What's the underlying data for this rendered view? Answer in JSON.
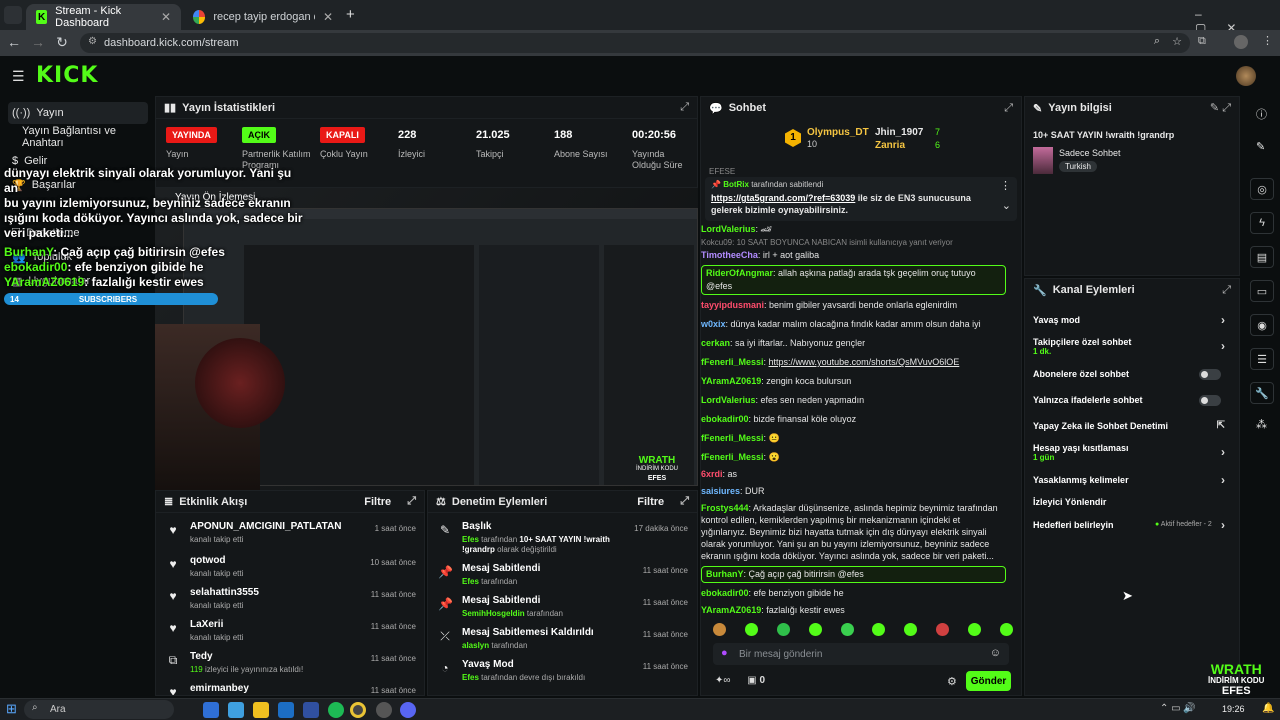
{
  "browser": {
    "tabs": [
      {
        "title": "Stream - Kick Dashboard",
        "active": true
      },
      {
        "title": "recep tayip erdogan dogum gu",
        "active": false
      }
    ],
    "url": "dashboard.kick.com/stream"
  },
  "sidebar": {
    "items": [
      {
        "label": "Yayın"
      },
      {
        "label": "Yayın Bağlantısı ve Anahtarı"
      },
      {
        "label": "Gelir"
      },
      {
        "label": "Başarılar"
      },
      {
        "label": "Denetleme"
      },
      {
        "label": "Topluluk"
      },
      {
        "label": "Uygulamalar"
      }
    ]
  },
  "stats": {
    "title": "Yayın İstatistikleri",
    "items": [
      {
        "value": "YAYINDA",
        "label": "Yayın"
      },
      {
        "value": "AÇIK",
        "label": "Partnerlik Katılım Programı"
      },
      {
        "value": "KAPALI",
        "label": "Çoklu Yayın"
      },
      {
        "value": "228",
        "label": "İzleyici"
      },
      {
        "value": "21.025",
        "label": "Takipçi"
      },
      {
        "value": "188",
        "label": "Abone Sayısı"
      },
      {
        "value": "00:20:56",
        "label": "Yayında Olduğu Süre"
      }
    ]
  },
  "preview": {
    "title": "Yayın Ön İzlemesi",
    "overlay_lines": [
      "dünyayı elektrik sinyali olarak yorumluyor. Yani şu an",
      "bu yayını izlemiyorsunuz, beyniniz sadece ekranın",
      "ışığını koda döküyor. Yayıncı aslında yok, sadece bir",
      "veri paketi..."
    ],
    "overlay_chat": [
      {
        "user": "BurhanY",
        "text": ": Çağ açıp çağ bitirirsin @efes"
      },
      {
        "user": "ebokadir00",
        "text": ": efe benziyon gibide he"
      },
      {
        "user": "YAramAZ0619",
        "text": ": fazlalığı kestir ewes"
      }
    ],
    "subs_count": "14",
    "subs_label": "SUBSCRIBERS",
    "watermark_line1": "WRATH",
    "watermark_line2": "İNDİRİM KODU",
    "watermark_line3": "EFES"
  },
  "activity": {
    "title": "Etkinlik Akışı",
    "filter": "Filtre",
    "rows": [
      {
        "name": "APONUN_AMCIGINI_PATLATAN",
        "sub": "kanalı takip etti",
        "time": "1 saat önce"
      },
      {
        "name": "qotwod",
        "sub": "kanalı takip etti",
        "time": "10 saat önce"
      },
      {
        "name": "selahattin3555",
        "sub": "kanalı takip etti",
        "time": "11 saat önce"
      },
      {
        "name": "LaXerii",
        "sub": "kanalı takip etti",
        "time": "11 saat önce"
      },
      {
        "name": "Tedy",
        "sub_highlight": "119",
        "sub": " izleyici ile yayınınıza katıldı!",
        "time": "11 saat önce"
      },
      {
        "name": "emirmanbey",
        "sub": "",
        "time": "11 saat önce"
      }
    ]
  },
  "modlog": {
    "title": "Denetim Eylemleri",
    "filter": "Filtre",
    "rows": [
      {
        "name": "Başlık",
        "who": "Efes",
        "sub": " tarafından ",
        "bold2": "10+ SAAT YAYIN !wraith !grandrp",
        "sub2": " olarak değiştirildi",
        "time": "17 dakika önce"
      },
      {
        "name": "Mesaj Sabitlendi",
        "who": "Efes",
        "sub": " tarafından",
        "time": "11 saat önce"
      },
      {
        "name": "Mesaj Sabitlendi",
        "who": "SemihHosgeldin",
        "sub": " tarafından",
        "time": "11 saat önce"
      },
      {
        "name": "Mesaj Sabitlemesi Kaldırıldı",
        "who": "alaslyn",
        "sub": " tarafından",
        "time": "11 saat önce"
      },
      {
        "name": "Yavaş Mod",
        "who": "Efes",
        "sub": " tarafından devre dışı bırakıldı",
        "time": "11 saat önce"
      }
    ]
  },
  "chat": {
    "title": "Sohbet",
    "leaders": [
      {
        "name": "Olympus_DT",
        "count": "10"
      },
      {
        "name": "Jhin_1907",
        "count": "7"
      },
      {
        "name": "Zanria",
        "count": "6"
      }
    ],
    "cut_top": "EFESE",
    "pinned": {
      "user": "BotRix",
      "by": " tarafından sabitlendi",
      "link": "https://gta5grand.com/?ref=63039",
      "text": " ile siz de EN3 sunucusuna gelerek bizimle oynayabilirsiniz."
    },
    "messages": [
      {
        "user": "LordValerius",
        "color": "#53fc18",
        "text": ": 🏎",
        "hl": false
      },
      {
        "user": "",
        "color": "#888",
        "text": "Kokcu09: 10 SAAT BOYUNCA NABICAN isimli kullanıcıya yanıt veriyor",
        "hl": false,
        "reply": true
      },
      {
        "user": "TimotheeCha",
        "color": "#b28cff",
        "text": ": irl + aot galiba",
        "hl": false
      },
      {
        "user": "RiderOfAngmar",
        "color": "#53fc18",
        "text": ": allah aşkına patlağı arada tşk geçelim oruç tutuyo @efes",
        "hl": true
      },
      {
        "user": "tayyipdusmani",
        "color": "#ff4d6d",
        "text": ": benim gibiler yavsardi bende onlarla eglenirdim",
        "hl": false
      },
      {
        "user": "w0xix",
        "color": "#6fb8ff",
        "text": ": dünya kadar malım olacağına fındık kadar amım olsun daha iyi",
        "hl": false
      },
      {
        "user": "cerkan",
        "color": "#53fc18",
        "text": ": sa iyi iftarlar.. Nabıyonuz gençler",
        "hl": false
      },
      {
        "user": "fFenerli_Messi",
        "color": "#53fc18",
        "text": ": ",
        "link": "https://www.youtube.com/shorts/QsMVuvO6lOE",
        "hl": false
      },
      {
        "user": "YAramAZ0619",
        "color": "#53fc18",
        "text": ": zengin koca bulursun",
        "hl": false
      },
      {
        "user": "LordValerius",
        "color": "#53fc18",
        "text": ": efes sen neden yapmadın",
        "hl": false
      },
      {
        "user": "ebokadir00",
        "color": "#53fc18",
        "text": ": bizde finansal köle oluyoz",
        "hl": false
      },
      {
        "user": "fFenerli_Messi",
        "color": "#53fc18",
        "text": ": 😐",
        "hl": false
      },
      {
        "user": "fFenerli_Messi",
        "color": "#53fc18",
        "text": ": 😮",
        "hl": false
      },
      {
        "user": "6xrdi",
        "color": "#ff4d6d",
        "text": ": as",
        "hl": false
      },
      {
        "user": "saisiures",
        "color": "#6fb8ff",
        "text": ": DUR",
        "hl": false
      },
      {
        "user": "Frostys444",
        "color": "#53fc18",
        "text": ": Arkadaşlar düşünsenize, aslında hepimiz beynimiz tarafından kontrol edilen, kemiklerden yapılmış bir mekanizmanın içindeki et yığınlarıyız. Beynimiz bizi hayatta tutmak için dış dünyayı elektrik sinyali olarak yorumluyor. Yani şu an bu yayını izlemiyorsunuz, beyniniz sadece ekranın ışığını koda döküyor. Yayıncı aslında yok, sadece bir veri paketi...",
        "hl": false
      },
      {
        "user": "BurhanY",
        "color": "#53fc18",
        "text": ": Çağ açıp çağ bitirirsin @efes",
        "hl": true
      },
      {
        "user": "ebokadir00",
        "color": "#53fc18",
        "text": ": efe benziyon gibide he",
        "hl": false
      },
      {
        "user": "YAramAZ0619",
        "color": "#53fc18",
        "text": ": fazlalığı kestir ewes",
        "hl": false
      }
    ],
    "input_placeholder": "Bir mesaj gönderin",
    "points": "0",
    "send_label": "Gönder"
  },
  "streaminfo": {
    "title": "Yayın bilgisi",
    "stream_title": "10+ SAAT YAYIN !wraith !grandrp",
    "category": "Sadece Sohbet",
    "tag": "Turkish"
  },
  "channel_actions": {
    "title": "Kanal Eylemleri",
    "items": [
      {
        "label": "Yavaş mod",
        "kind": "chevron"
      },
      {
        "label": "Takipçilere özel sohbet",
        "sub": "1 dk.",
        "kind": "chevron"
      },
      {
        "label": "Abonelere özel sohbet",
        "kind": "toggle"
      },
      {
        "label": "Yalnızca ifadelerle sohbet",
        "kind": "toggle"
      },
      {
        "label": "Yapay Zeka ile Sohbet Denetimi",
        "kind": "external"
      },
      {
        "label": "Hesap yaşı kısıtlaması",
        "sub": "1 gün",
        "kind": "chevron"
      },
      {
        "label": "Yasaklanmış kelimeler",
        "kind": "chevron"
      },
      {
        "label": "İzleyici Yönlendir",
        "kind": "none"
      },
      {
        "label": "Hedefleri belirleyin",
        "status": "Aktif hedefler - 2",
        "kind": "chevron"
      }
    ]
  },
  "taskbar": {
    "search": "Ara",
    "time": "19:26"
  },
  "colors": {
    "accent": "#53fc18",
    "live": "#e91916",
    "bg": "#0b0e0f",
    "panel": "#141719"
  }
}
